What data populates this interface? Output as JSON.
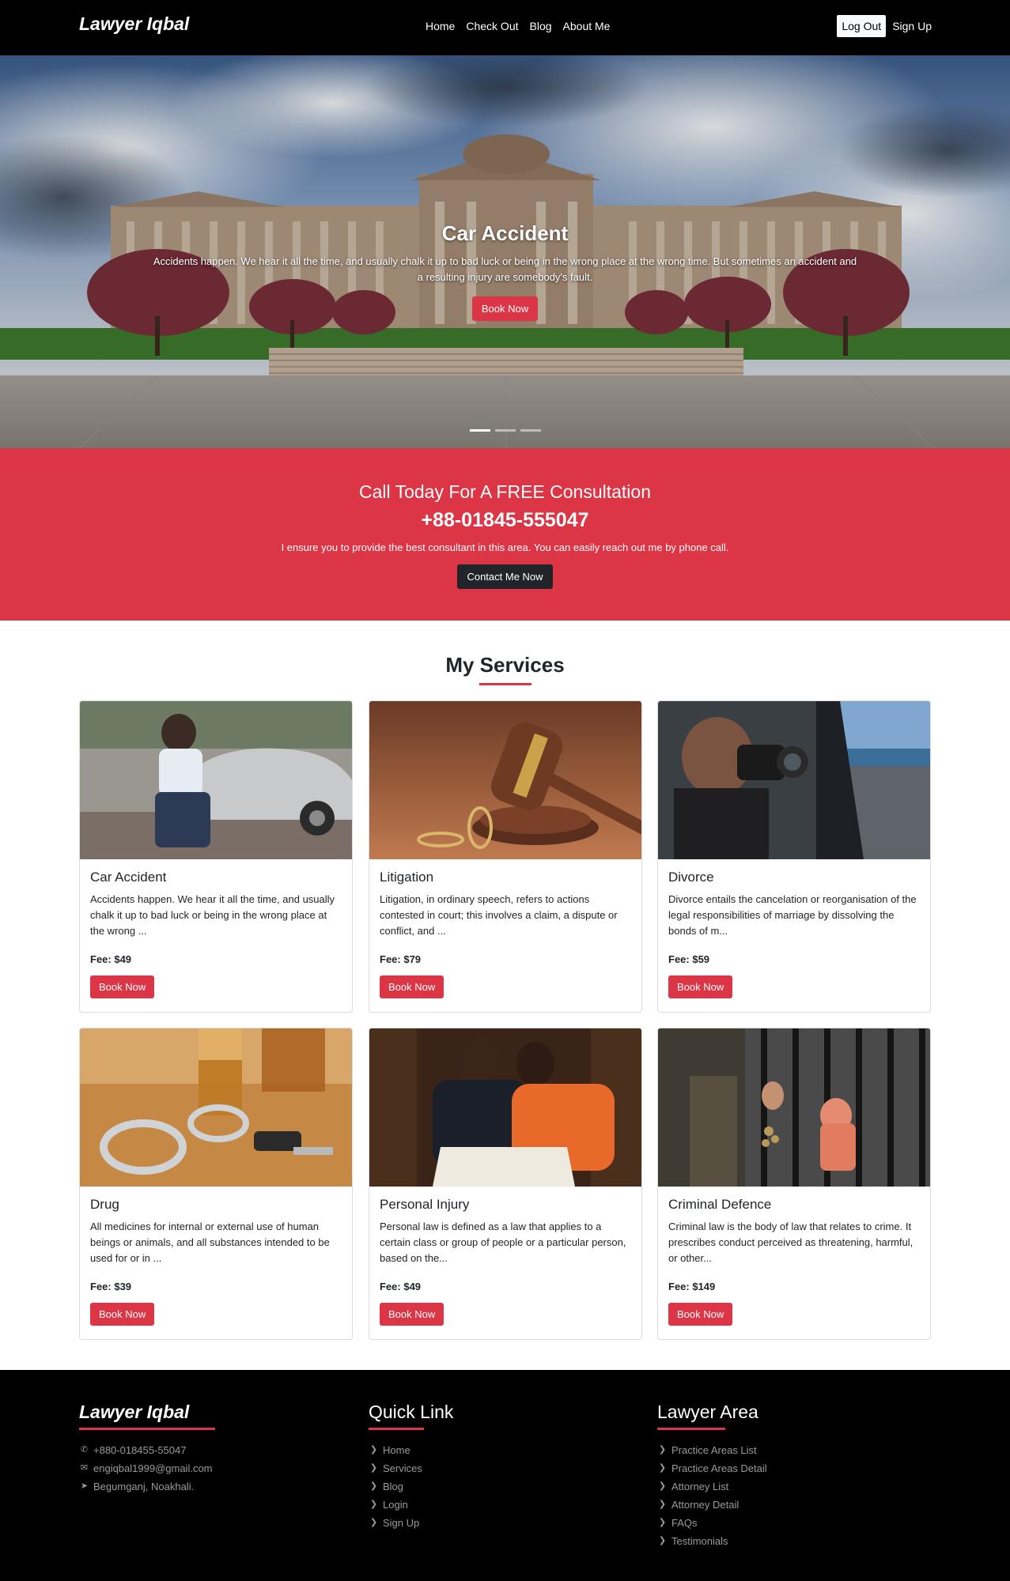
{
  "nav": {
    "brand": "Lawyer Iqbal",
    "links": [
      "Home",
      "Check Out",
      "Blog",
      "About Me"
    ],
    "logout": "Log Out",
    "signup": "Sign Up"
  },
  "hero": {
    "title": "Car Accident",
    "text": "Accidents happen. We hear it all the time, and usually chalk it up to bad luck or being in the wrong place at the wrong time. But sometimes an accident and a resulting injury are somebody's fault.",
    "button": "Book Now",
    "active_slide": 1,
    "slide_count": 3
  },
  "cta": {
    "title": "Call Today For A FREE Consultation",
    "phone": "+88-01845-555047",
    "text": "I ensure you to provide the best consultant in this area. You can easily reach out me by phone call.",
    "button": "Contact Me Now"
  },
  "services": {
    "title": "My Services",
    "items": [
      {
        "title": "Car Accident",
        "text": "Accidents happen. We hear it all the time, and usually chalk it up to bad luck or being in the wrong place at the wrong ...",
        "fee": "Fee: $49",
        "button": "Book Now"
      },
      {
        "title": "Litigation",
        "text": "Litigation, in ordinary speech, refers to actions contested in court; this involves a claim, a dispute or conflict, and ...",
        "fee": "Fee: $79",
        "button": "Book Now"
      },
      {
        "title": "Divorce",
        "text": "Divorce entails the cancelation or reorganisation of the legal responsibilities of marriage by dissolving the bonds of m...",
        "fee": "Fee: $59",
        "button": "Book Now"
      },
      {
        "title": "Drug",
        "text": "All medicines for internal or external use of human beings or animals, and all substances intended to be used for or in ...",
        "fee": "Fee: $39",
        "button": "Book Now"
      },
      {
        "title": "Personal Injury",
        "text": "Personal law is defined as a law that applies to a certain class or group of people or a particular person, based on the...",
        "fee": "Fee: $49",
        "button": "Book Now"
      },
      {
        "title": "Criminal Defence",
        "text": "Criminal law is the body of law that relates to crime. It prescribes conduct perceived as threatening, harmful, or other...",
        "fee": "Fee: $149",
        "button": "Book Now"
      }
    ]
  },
  "footer": {
    "col1": {
      "title": "Lawyer Iqbal",
      "items": [
        {
          "icon": "phone-icon",
          "text": "+880-018455-55047"
        },
        {
          "icon": "envelope-icon",
          "text": "engiqbal1999@gmail.com"
        },
        {
          "icon": "location-arrow-icon",
          "text": "Begumganj, Noakhali."
        }
      ]
    },
    "col2": {
      "title": "Quick Link",
      "items": [
        "Home",
        "Services",
        "Blog",
        "Login",
        "Sign Up"
      ]
    },
    "col3": {
      "title": "Lawyer Area",
      "items": [
        "Practice Areas List",
        "Practice Areas Detail",
        "Attorney List",
        "Attorney Detail",
        "FAQs",
        "Testimonials"
      ]
    }
  },
  "colors": {
    "accent": "#dc3545",
    "dark": "#000000",
    "button_dark": "#212529"
  }
}
